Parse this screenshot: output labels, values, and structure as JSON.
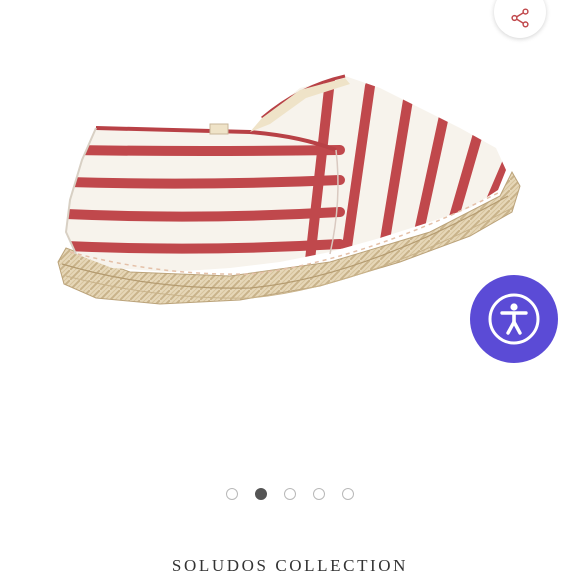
{
  "product": {
    "image_alt": "Red and white striped espadrille slip-on shoe",
    "collection_label": "SOLUDOS COLLECTION"
  },
  "carousel": {
    "total_slides": 5,
    "active_index": 1
  },
  "controls": {
    "share_icon": "share-icon",
    "accessibility_icon": "accessibility-icon"
  },
  "colors": {
    "accent": "#5b4bd6",
    "stripe": "#c0484c",
    "dot_active": "#555555"
  }
}
